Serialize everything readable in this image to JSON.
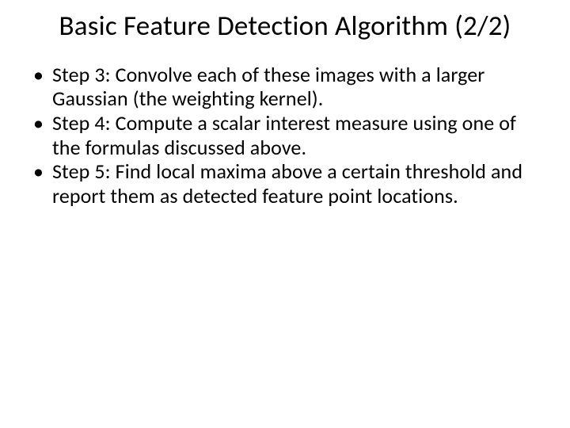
{
  "slide": {
    "title": "Basic Feature Detection Algorithm (2/2)",
    "bullets": [
      "Step 3: Convolve each of these images with a larger Gaussian (the weighting kernel).",
      "Step 4: Compute a scalar interest measure using one of the formulas discussed above.",
      "Step 5: Find local maxima above a certain threshold and report them as detected feature point locations."
    ]
  }
}
